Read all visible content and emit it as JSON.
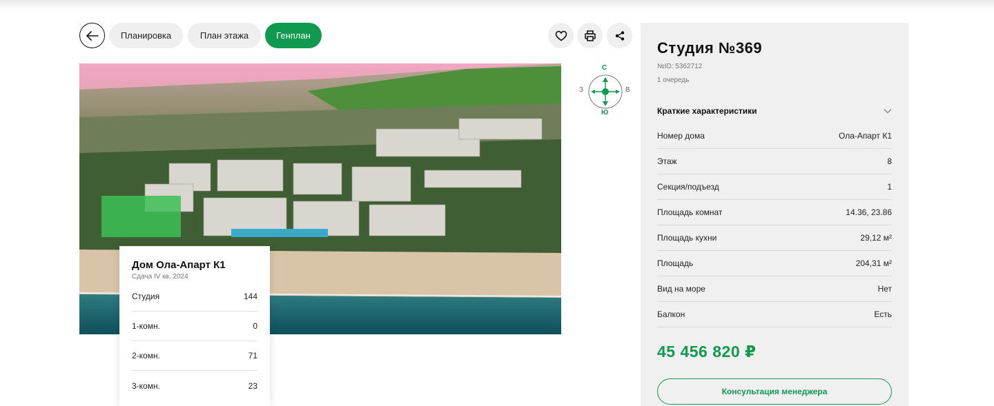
{
  "tabs": [
    {
      "label": "Планировка",
      "active": false
    },
    {
      "label": "План этажа",
      "active": false
    },
    {
      "label": "Генплан",
      "active": true
    }
  ],
  "toolbar": {
    "back_icon": "arrow-left-icon",
    "favorite_icon": "heart-icon",
    "print_icon": "printer-icon",
    "share_icon": "share-icon"
  },
  "compass": {
    "north": "С",
    "south": "Ю",
    "west": "З",
    "east": "В"
  },
  "house_card": {
    "title": "Дом Ола-Апарт К1",
    "subtitle": "Сдача IV кв. 2024",
    "rows": [
      {
        "label": "Студия",
        "value": "144"
      },
      {
        "label": "1-комн.",
        "value": "0"
      },
      {
        "label": "2-комн.",
        "value": "71"
      },
      {
        "label": "3-комн.",
        "value": "23"
      }
    ]
  },
  "apartment": {
    "title": "Студия №369",
    "id_line": "№ID: 5362712",
    "queue": "1 очередь",
    "specs_title": "Краткие характеристики",
    "specs": [
      {
        "label": "Номер дома",
        "value": "Ола-Апарт К1"
      },
      {
        "label": "Этаж",
        "value": "8"
      },
      {
        "label": "Секция/подъезд",
        "value": "1"
      },
      {
        "label": "Площадь комнат",
        "value": "14.36, 23.86"
      },
      {
        "label": "Площадь кухни",
        "value": "29,12 м²"
      },
      {
        "label": "Площадь",
        "value": "204,31 м²"
      },
      {
        "label": "Вид на море",
        "value": "Нет"
      },
      {
        "label": "Балкон",
        "value": "Есть"
      }
    ],
    "price": "45 456 820 ₽",
    "consult_label": "Консультация менеджера"
  },
  "colors": {
    "accent": "#0f9a4f",
    "panel_bg": "#f0f0f0",
    "tab_bg": "#efefef"
  }
}
